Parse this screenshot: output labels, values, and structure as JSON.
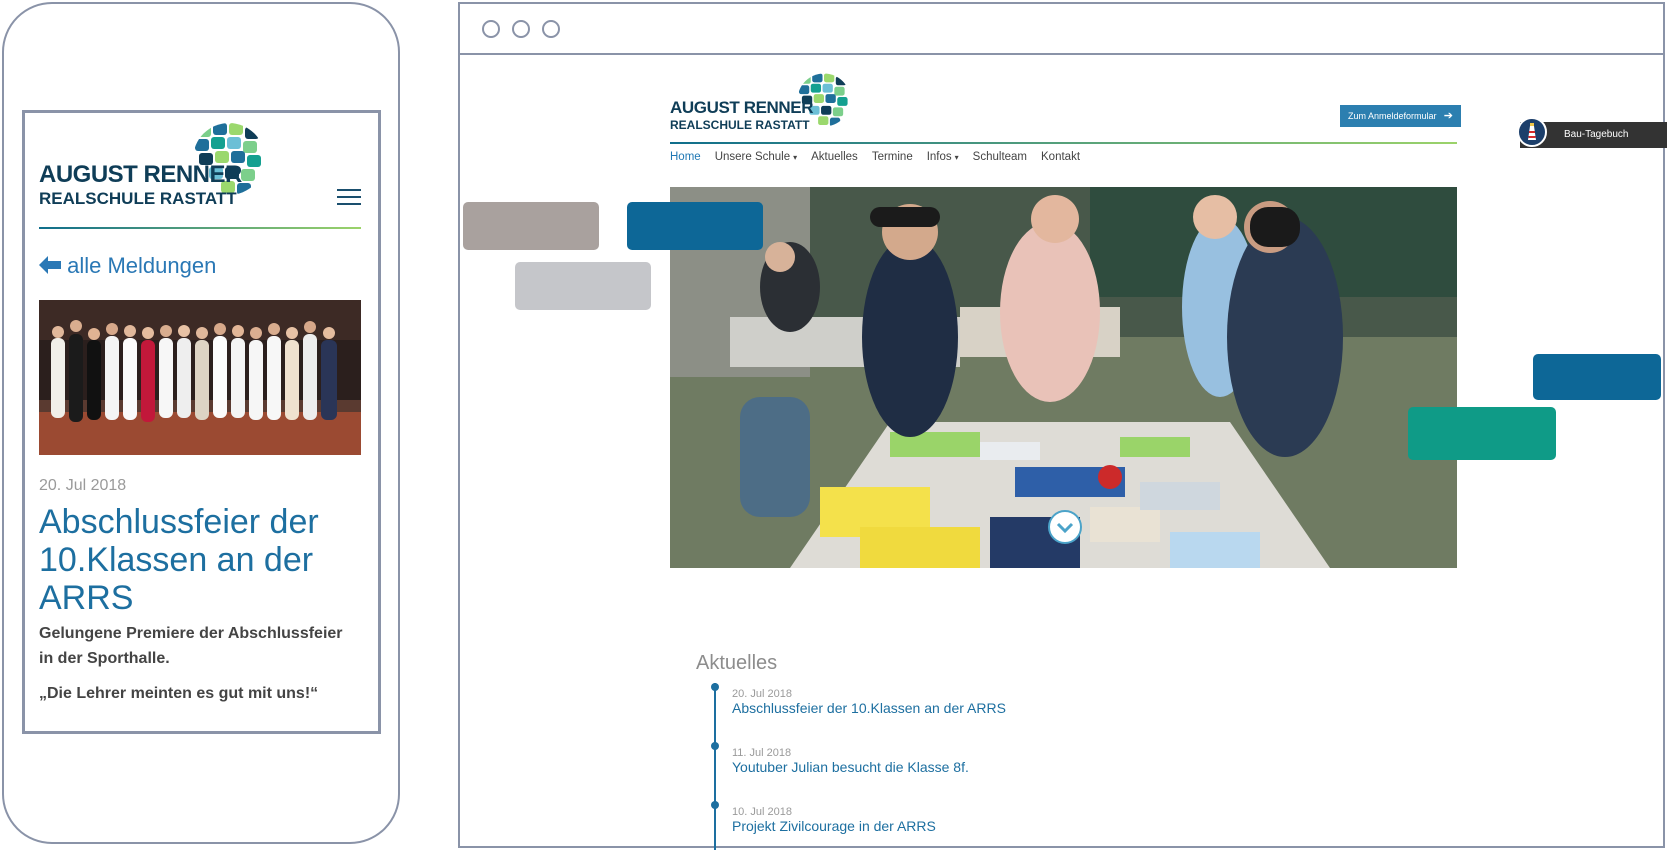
{
  "mobile": {
    "logo_line1": "AUGUST RENNER",
    "logo_line2": "REALSCHULE RASTATT",
    "back_label": "alle Meldungen",
    "date": "20. Jul 2018",
    "title": "Abschlussfeier der 10.Klassen an der ARRS",
    "lead": "Gelungene Premiere der Abschlussfeier in der Sporthalle.",
    "quote": "„Die Lehrer meinten es gut mit uns!“"
  },
  "desktop": {
    "logo_line1": "AUGUST RENNER",
    "logo_line2": "REALSCHULE RASTATT",
    "cta_label": "Zum Anmeldeformular",
    "bau_label": "Bau-Tagebuch",
    "nav": [
      "Home",
      "Unsere Schule",
      "Aktuelles",
      "Termine",
      "Infos",
      "Schulteam",
      "Kontakt"
    ],
    "news_heading": "Aktuelles",
    "news": [
      {
        "date": "20. Jul 2018",
        "title": "Abschlussfeier der 10.Klassen an der ARRS"
      },
      {
        "date": "11. Jul 2018",
        "title": "Youtuber Julian besucht die Klasse 8f."
      },
      {
        "date": "10. Jul 2018",
        "title": "Projekt Zivilcourage in der ARRS"
      }
    ]
  },
  "colors": {
    "brand": "#1d6fa0",
    "navy": "#0f3d57",
    "frame": "#8a93a8",
    "teal_block": "#0f9b87",
    "blue_block": "#0d6797",
    "grey_block": "#a9a19e",
    "light_block": "#c5c6ca"
  },
  "icons": [
    "menu-icon",
    "arrow-left-icon",
    "arrow-right-icon",
    "chevron-down-icon",
    "lighthouse-icon",
    "window-dot-icon"
  ]
}
